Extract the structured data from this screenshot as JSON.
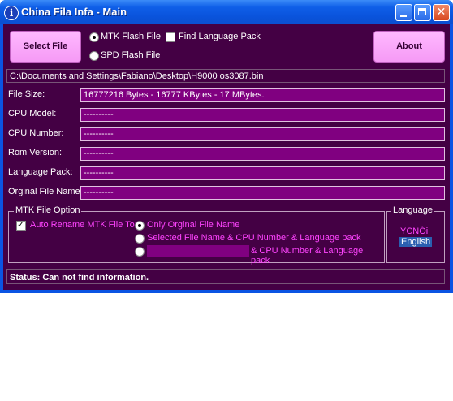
{
  "window": {
    "title": "China Fila Infa - Main",
    "icon_glyph": "i"
  },
  "toolbar": {
    "select_file_label": "Select File",
    "about_label": "About",
    "mtk_label": "MTK Flash File",
    "spd_label": "SPD Flash File",
    "find_lang_label": "Find Language Pack",
    "selected_mode": "MTK Flash File",
    "find_lang_checked": false
  },
  "path": "C:\\Documents and Settings\\Fabiano\\Desktop\\H9000 os3087.bin",
  "fields": {
    "file_size_label": "File Size:",
    "file_size_value": "16777216 Bytes - 16777 KBytes - 17 MBytes.",
    "cpu_model_label": "CPU Model:",
    "cpu_model_value": "----------",
    "cpu_number_label": "CPU Number:",
    "cpu_number_value": "----------",
    "rom_version_label": "Rom Version:",
    "rom_version_value": "----------",
    "language_pack_label": "Language Pack:",
    "language_pack_value": "----------",
    "original_name_label": "Orginal File Name:",
    "original_name_value": "----------"
  },
  "mtk_option": {
    "legend": "MTK File Option",
    "auto_rename_label": "Auto Rename MTK File To:",
    "auto_rename_checked": true,
    "opt1": "Only Orginal File Name",
    "opt2": "Selected File Name & CPU Number & Language pack",
    "opt3_suffix": "& CPU Number & Language pack",
    "opt3_input": ""
  },
  "language": {
    "legend": "Language",
    "items": [
      "YCNÓi",
      "English"
    ],
    "selected": "English"
  },
  "status": "Status: Can not find information.",
  "colors": {
    "client_bg": "#440044",
    "field_bg": "#800080",
    "button_bg": "#f5a0f5",
    "accent_text": "#ff44ff",
    "titlebar": "#0a53db"
  }
}
